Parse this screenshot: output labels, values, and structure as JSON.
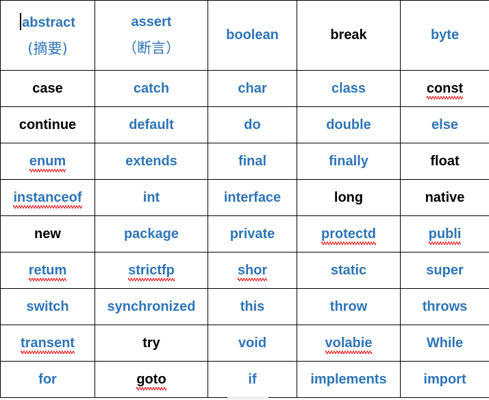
{
  "document": {
    "type": "java-keyword-table",
    "columns": 5,
    "rows": 10,
    "colors": {
      "keyword_blue": "#2E75B6",
      "keyword_black": "#000000",
      "spellcheck_underline": "#e8262a",
      "cell_border": "#000000",
      "background": "#ffffff"
    },
    "caret_visible": true
  },
  "table": {
    "rows": [
      {
        "tall": true,
        "cells": [
          {
            "text": "abstract",
            "color": "blue",
            "misspelled": false,
            "caret": true,
            "sub": "(摘要)"
          },
          {
            "text": "assert",
            "color": "blue",
            "misspelled": false,
            "caret": false,
            "sub": "（断言）"
          },
          {
            "text": "boolean",
            "color": "blue",
            "misspelled": false,
            "caret": false,
            "sub": ""
          },
          {
            "text": "break",
            "color": "black",
            "misspelled": false,
            "caret": false,
            "sub": ""
          },
          {
            "text": "byte",
            "color": "blue",
            "misspelled": false,
            "caret": false,
            "sub": ""
          }
        ]
      },
      {
        "tall": false,
        "cells": [
          {
            "text": "case",
            "color": "black",
            "misspelled": false,
            "caret": false,
            "sub": ""
          },
          {
            "text": "catch",
            "color": "blue",
            "misspelled": false,
            "caret": false,
            "sub": ""
          },
          {
            "text": "char",
            "color": "blue",
            "misspelled": false,
            "caret": false,
            "sub": ""
          },
          {
            "text": "class",
            "color": "blue",
            "misspelled": false,
            "caret": false,
            "sub": ""
          },
          {
            "text": "const",
            "color": "black",
            "misspelled": true,
            "caret": false,
            "sub": ""
          }
        ]
      },
      {
        "tall": false,
        "cells": [
          {
            "text": "continue",
            "color": "black",
            "misspelled": false,
            "caret": false,
            "sub": ""
          },
          {
            "text": "default",
            "color": "blue",
            "misspelled": false,
            "caret": false,
            "sub": ""
          },
          {
            "text": "do",
            "color": "blue",
            "misspelled": false,
            "caret": false,
            "sub": ""
          },
          {
            "text": "double",
            "color": "blue",
            "misspelled": false,
            "caret": false,
            "sub": ""
          },
          {
            "text": "else",
            "color": "blue",
            "misspelled": false,
            "caret": false,
            "sub": ""
          }
        ]
      },
      {
        "tall": false,
        "cells": [
          {
            "text": "enum",
            "color": "blue",
            "misspelled": true,
            "caret": false,
            "sub": ""
          },
          {
            "text": "extends",
            "color": "blue",
            "misspelled": false,
            "caret": false,
            "sub": ""
          },
          {
            "text": "final",
            "color": "blue",
            "misspelled": false,
            "caret": false,
            "sub": ""
          },
          {
            "text": "finally",
            "color": "blue",
            "misspelled": false,
            "caret": false,
            "sub": ""
          },
          {
            "text": "float",
            "color": "black",
            "misspelled": false,
            "caret": false,
            "sub": ""
          }
        ]
      },
      {
        "tall": false,
        "cells": [
          {
            "text": "instanceof",
            "color": "blue",
            "misspelled": true,
            "caret": false,
            "sub": ""
          },
          {
            "text": "int",
            "color": "blue",
            "misspelled": false,
            "caret": false,
            "sub": ""
          },
          {
            "text": "interface",
            "color": "blue",
            "misspelled": false,
            "caret": false,
            "sub": ""
          },
          {
            "text": "long",
            "color": "black",
            "misspelled": false,
            "caret": false,
            "sub": ""
          },
          {
            "text": "native",
            "color": "black",
            "misspelled": false,
            "caret": false,
            "sub": ""
          }
        ]
      },
      {
        "tall": false,
        "cells": [
          {
            "text": "new",
            "color": "black",
            "misspelled": false,
            "caret": false,
            "sub": ""
          },
          {
            "text": "package",
            "color": "blue",
            "misspelled": false,
            "caret": false,
            "sub": ""
          },
          {
            "text": "private",
            "color": "blue",
            "misspelled": false,
            "caret": false,
            "sub": ""
          },
          {
            "text": "protectd",
            "color": "blue",
            "misspelled": true,
            "caret": false,
            "sub": ""
          },
          {
            "text": "publi",
            "color": "blue",
            "misspelled": true,
            "caret": false,
            "sub": ""
          }
        ]
      },
      {
        "tall": false,
        "cells": [
          {
            "text": "retum",
            "color": "blue",
            "misspelled": true,
            "caret": false,
            "sub": ""
          },
          {
            "text": "strictfp",
            "color": "blue",
            "misspelled": true,
            "caret": false,
            "sub": ""
          },
          {
            "text": "shor",
            "color": "blue",
            "misspelled": true,
            "caret": false,
            "sub": ""
          },
          {
            "text": "static",
            "color": "blue",
            "misspelled": false,
            "caret": false,
            "sub": ""
          },
          {
            "text": "super",
            "color": "blue",
            "misspelled": false,
            "caret": false,
            "sub": ""
          }
        ]
      },
      {
        "tall": false,
        "cells": [
          {
            "text": "switch",
            "color": "blue",
            "misspelled": false,
            "caret": false,
            "sub": ""
          },
          {
            "text": "synchronized",
            "color": "blue",
            "misspelled": false,
            "caret": false,
            "sub": ""
          },
          {
            "text": "this",
            "color": "blue",
            "misspelled": false,
            "caret": false,
            "sub": ""
          },
          {
            "text": "throw",
            "color": "blue",
            "misspelled": false,
            "caret": false,
            "sub": ""
          },
          {
            "text": "throws",
            "color": "blue",
            "misspelled": false,
            "caret": false,
            "sub": ""
          }
        ]
      },
      {
        "tall": false,
        "cells": [
          {
            "text": "transent",
            "color": "blue",
            "misspelled": true,
            "caret": false,
            "sub": ""
          },
          {
            "text": "try",
            "color": "black",
            "misspelled": false,
            "caret": false,
            "sub": ""
          },
          {
            "text": "void",
            "color": "blue",
            "misspelled": false,
            "caret": false,
            "sub": ""
          },
          {
            "text": "volabie",
            "color": "blue",
            "misspelled": true,
            "caret": false,
            "sub": ""
          },
          {
            "text": "While",
            "color": "blue",
            "misspelled": false,
            "caret": false,
            "sub": ""
          }
        ]
      },
      {
        "tall": false,
        "cells": [
          {
            "text": "for",
            "color": "blue",
            "misspelled": false,
            "caret": false,
            "sub": ""
          },
          {
            "text": "goto",
            "color": "black",
            "misspelled": true,
            "caret": false,
            "sub": ""
          },
          {
            "text": "if",
            "color": "blue",
            "misspelled": false,
            "caret": false,
            "sub": ""
          },
          {
            "text": "implements",
            "color": "blue",
            "misspelled": false,
            "caret": false,
            "sub": ""
          },
          {
            "text": "import",
            "color": "blue",
            "misspelled": false,
            "caret": false,
            "sub": ""
          }
        ]
      }
    ]
  }
}
